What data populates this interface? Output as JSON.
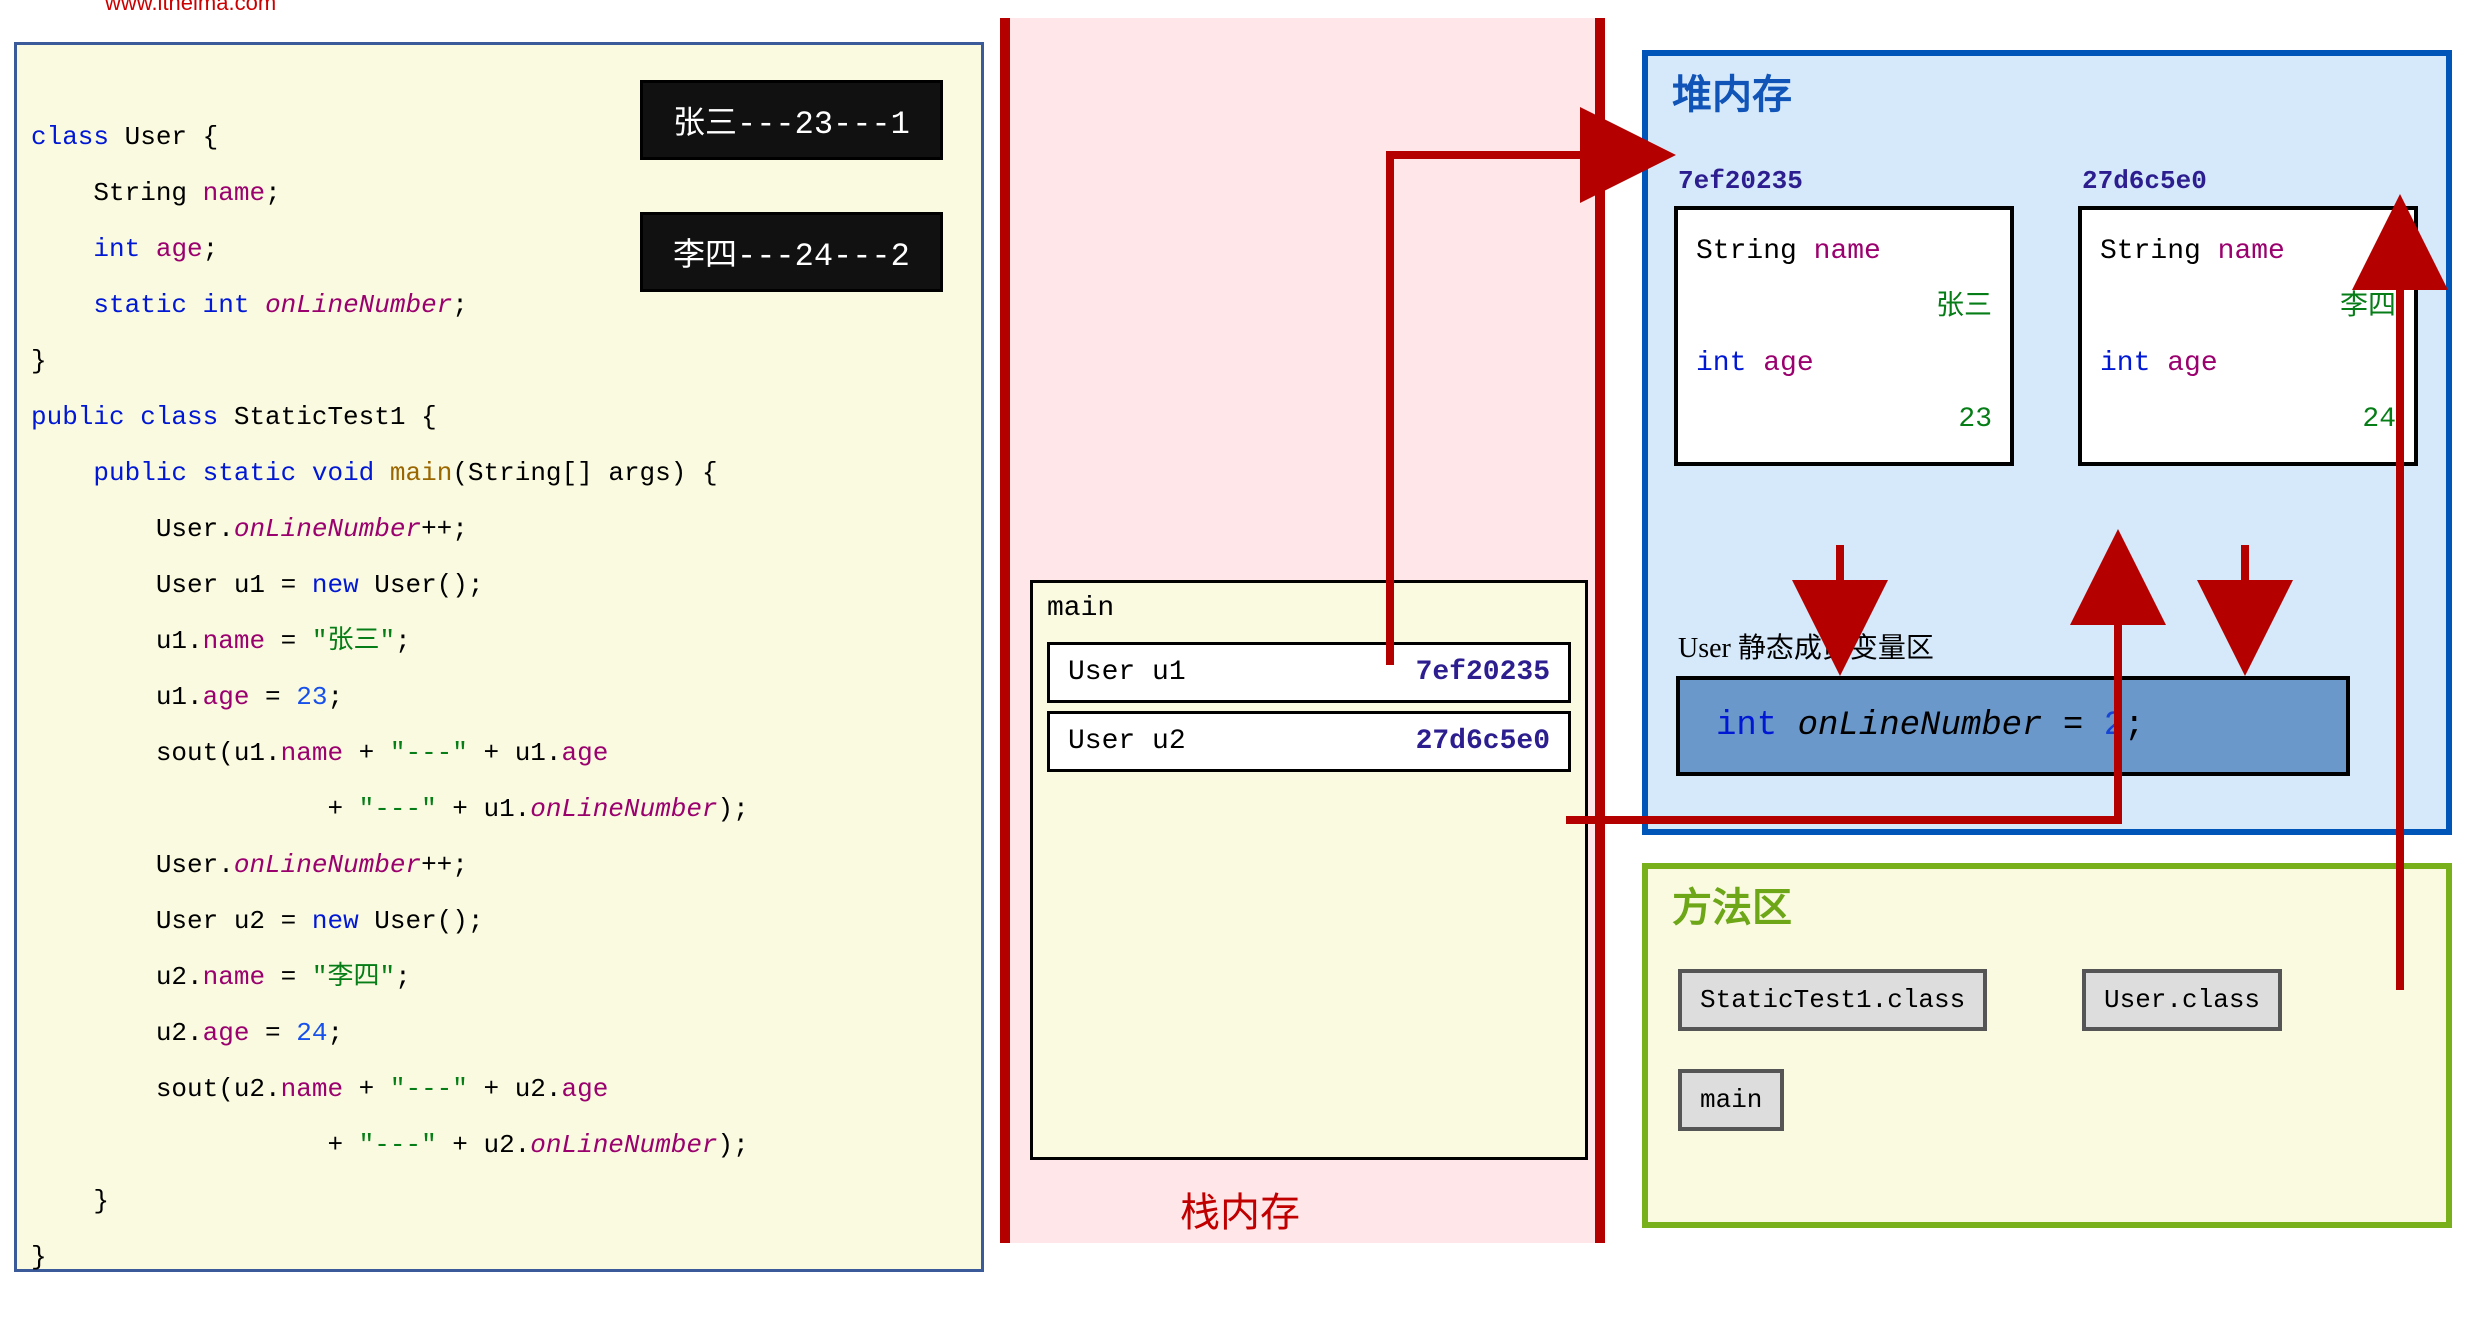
{
  "site_url": "www.itheima.com",
  "output": {
    "line1": "张三---23---1",
    "line2": "李四---24---2"
  },
  "code": {
    "class1_name": "User",
    "field_name": "name",
    "field_age": "age",
    "field_online": "onLineNumber",
    "class2_name": "StaticTest1",
    "main_name": "main",
    "main_args": "(String[] args) {",
    "line_inc1": "User.",
    "line_inc1_suffix": "++;",
    "u1_decl": "        User u1 = ",
    "u1_new": "new",
    "u1_suffix": " User();",
    "u1_name_assign": "u1.",
    "u1_name_val": "\"张三\"",
    "u1_age_assign": "u1.",
    "u1_age_val": "23",
    "sout_u1a": "        sout(u1.",
    "sout_sep": "\"---\"",
    "sout_u1b": " + u1.",
    "line_inc2": "User.",
    "u2_decl": "        User u2 = ",
    "u2_new": "new",
    "u2_suffix": " User();",
    "u2_name_assign": "u2.",
    "u2_name_val": "\"李四\"",
    "u2_age_assign": "u2.",
    "u2_age_val": "24",
    "sout_u2a": "        sout(u2.",
    "sout_u2b": " + u2."
  },
  "stack": {
    "title": "栈内存",
    "frame_name": "main",
    "u1_label": "User u1",
    "u1_addr": "7ef20235",
    "u2_label": "User u2",
    "u2_addr": "27d6c5e0"
  },
  "heap": {
    "title": "堆内存",
    "addr1": "7ef20235",
    "addr2": "27d6c5e0",
    "obj1": {
      "name_label": "String",
      "name_field": "name",
      "name_val": "张三",
      "age_label": "int",
      "age_field": "age",
      "age_val": "23"
    },
    "obj2": {
      "name_label": "String",
      "name_field": "name",
      "name_val": "李四",
      "age_label": "int",
      "age_field": "age",
      "age_val": "24"
    },
    "static_area_label": "User 静态成员变量区",
    "static_box": {
      "type": "int",
      "field": "onLineNumber",
      "val": "2"
    }
  },
  "method_area": {
    "title": "方法区",
    "class1": "StaticTest1.class",
    "class2": "User.class",
    "method": "main"
  }
}
